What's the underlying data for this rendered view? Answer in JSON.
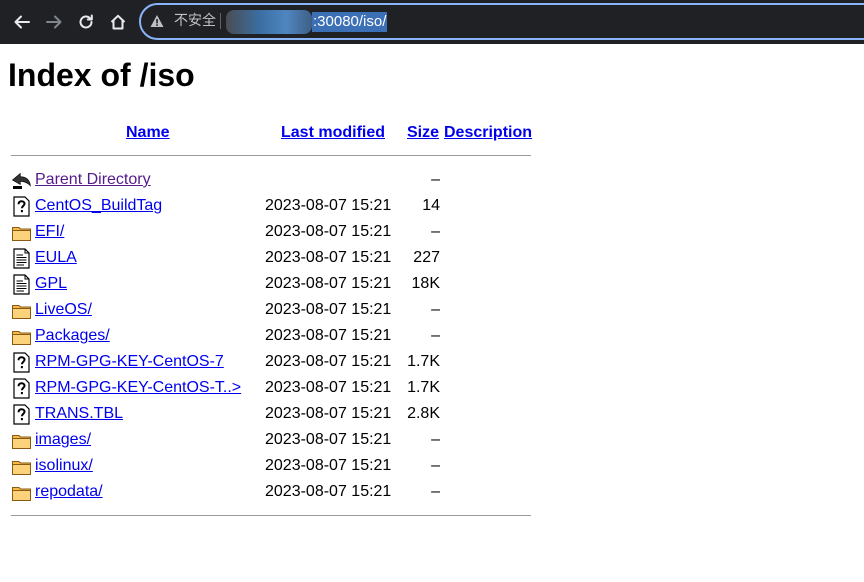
{
  "browser": {
    "security_label": "不安全",
    "url_visible": ":30080/iso/"
  },
  "page": {
    "title": "Index of /iso",
    "columns": {
      "name": "Name",
      "last_modified": "Last modified",
      "size": "Size",
      "description": "Description"
    },
    "entries": [
      {
        "icon": "back-icon",
        "name": "Parent Directory",
        "modified": "",
        "size": "–"
      },
      {
        "icon": "unknown-file-icon",
        "name": "CentOS_BuildTag",
        "modified": "2023-08-07 15:21",
        "size": "14"
      },
      {
        "icon": "folder-icon",
        "name": "EFI/",
        "modified": "2023-08-07 15:21",
        "size": "–"
      },
      {
        "icon": "text-file-icon",
        "name": "EULA",
        "modified": "2023-08-07 15:21",
        "size": "227"
      },
      {
        "icon": "text-file-icon",
        "name": "GPL",
        "modified": "2023-08-07 15:21",
        "size": "18K"
      },
      {
        "icon": "folder-icon",
        "name": "LiveOS/",
        "modified": "2023-08-07 15:21",
        "size": "–"
      },
      {
        "icon": "folder-icon",
        "name": "Packages/",
        "modified": "2023-08-07 15:21",
        "size": "–"
      },
      {
        "icon": "unknown-file-icon",
        "name": "RPM-GPG-KEY-CentOS-7",
        "modified": "2023-08-07 15:21",
        "size": "1.7K"
      },
      {
        "icon": "unknown-file-icon",
        "name": "RPM-GPG-KEY-CentOS-T..>",
        "modified": "2023-08-07 15:21",
        "size": "1.7K"
      },
      {
        "icon": "unknown-file-icon",
        "name": "TRANS.TBL",
        "modified": "2023-08-07 15:21",
        "size": "2.8K"
      },
      {
        "icon": "folder-icon",
        "name": "images/",
        "modified": "2023-08-07 15:21",
        "size": "–"
      },
      {
        "icon": "folder-icon",
        "name": "isolinux/",
        "modified": "2023-08-07 15:21",
        "size": "–"
      },
      {
        "icon": "folder-icon",
        "name": "repodata/",
        "modified": "2023-08-07 15:21",
        "size": "–"
      }
    ]
  }
}
